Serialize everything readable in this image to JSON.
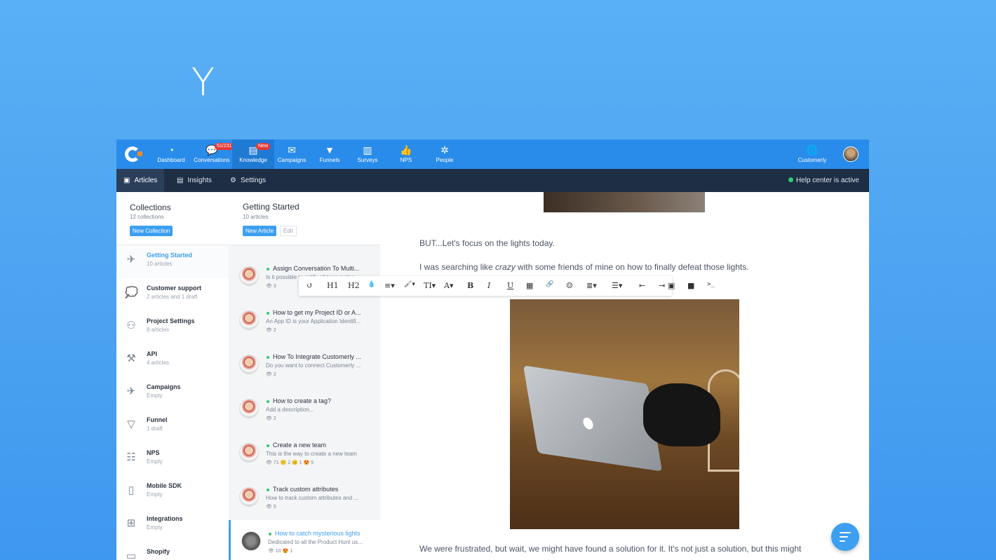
{
  "hero": {
    "letter": "Y"
  },
  "topnav": {
    "items": [
      {
        "label": "Dashboard",
        "icon": "gauge-icon"
      },
      {
        "label": "Conversations",
        "icon": "chat-bubbles-icon",
        "badge": "51/231"
      },
      {
        "label": "Knowledge",
        "icon": "book-icon",
        "badge": "New"
      },
      {
        "label": "Campaigns",
        "icon": "envelope-icon"
      },
      {
        "label": "Funnels",
        "icon": "funnel-icon"
      },
      {
        "label": "Surveys",
        "icon": "bar-chart-icon"
      },
      {
        "label": "NPS",
        "icon": "thumbs-up-icon"
      },
      {
        "label": "People",
        "icon": "people-network-icon"
      }
    ],
    "workspace_label": "Customerly"
  },
  "subnav": {
    "items": [
      {
        "label": "Articles"
      },
      {
        "label": "Insights"
      },
      {
        "label": "Settings"
      }
    ],
    "status": "Help center is active"
  },
  "collections": {
    "title": "Collections",
    "count": "12 collections",
    "new_button": "New Collection",
    "items": [
      {
        "name": "Getting Started",
        "sub": "10 articles",
        "icon": "paper-plane-icon"
      },
      {
        "name": "Customer support",
        "sub": "2 articles and 1 draft",
        "icon": "speech-bubble-icon"
      },
      {
        "name": "Project Settings",
        "sub": "8 articles",
        "icon": "team-icon"
      },
      {
        "name": "API",
        "sub": "4 articles",
        "icon": "api-icon"
      },
      {
        "name": "Campaigns",
        "sub": "Empty",
        "icon": "paper-plane-icon"
      },
      {
        "name": "Funnel",
        "sub": "1 draft",
        "icon": "funnel-icon"
      },
      {
        "name": "NPS",
        "sub": "Empty",
        "icon": "nps-icon"
      },
      {
        "name": "Mobile SDK",
        "sub": "Empty",
        "icon": "mobile-icon"
      },
      {
        "name": "Integrations",
        "sub": "Empty",
        "icon": "integrations-icon"
      },
      {
        "name": "Shopify",
        "sub": "",
        "icon": "shop-icon"
      }
    ]
  },
  "articles": {
    "title": "Getting Started",
    "count": "10 articles",
    "new_button": "New Article",
    "edit_button": "Edit",
    "items": [
      {
        "title": "Assign Conversation To Multi...",
        "desc": "Is it possible to notify all teammates...",
        "stats": "👁 3"
      },
      {
        "title": "How to get my Project ID or A...",
        "desc": "An App ID is your Application Identifi...",
        "stats": "👁 2"
      },
      {
        "title": "How To Integrate Customerly ...",
        "desc": "Do you want to connect Customerly ...",
        "stats": "👁 2"
      },
      {
        "title": "How to create a tag?",
        "desc": "Add a description...",
        "stats": "👁 2"
      },
      {
        "title": "Create a new team",
        "desc": "This is the way to create a new team",
        "stats": "👁 71 😕 2 😐 1 😍 5"
      },
      {
        "title": "Track custom attributes",
        "desc": "How to track custom attributes and ...",
        "stats": "👁 5"
      },
      {
        "title": "How to catch mysterious lights",
        "desc": "Dedicated to all the Product Hunt us...",
        "stats": "👁 10 😍 1"
      }
    ]
  },
  "editor": {
    "para1": "BUT...Let's focus on the lights today.",
    "para2_before": "I was searching like ",
    "para2_em": "crazy",
    "para2_after": " with some friends of mine on how to finally defeat those lights.",
    "para3": "We were frustrated, but wait, we might have found a solution for it. It's not just a solution, but this might",
    "toolbar": [
      "↺",
      "H1",
      "H2",
      "💧",
      "≡▾",
      "🖌▾",
      "TI▾",
      "A▾",
      "B",
      "I",
      "U",
      "▦",
      "🔗",
      "☺",
      "≣▾",
      "☰▾",
      "⇤",
      "⇥",
      "▣",
      "■",
      ">_"
    ]
  }
}
